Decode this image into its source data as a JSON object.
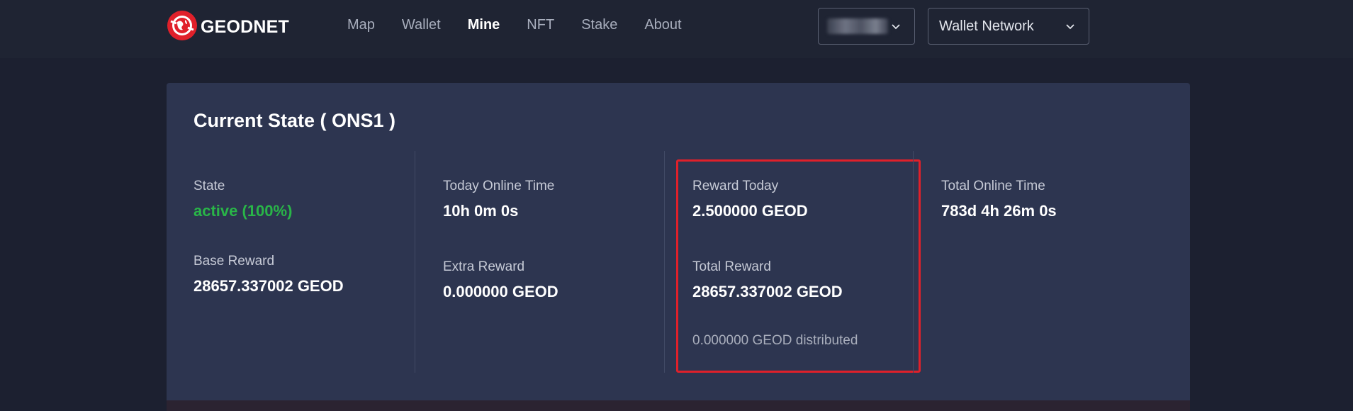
{
  "header": {
    "brand": "GEODNET",
    "nav": [
      {
        "label": "Map",
        "active": false
      },
      {
        "label": "Wallet",
        "active": false
      },
      {
        "label": "Mine",
        "active": true
      },
      {
        "label": "NFT",
        "active": false
      },
      {
        "label": "Stake",
        "active": false
      },
      {
        "label": "About",
        "active": false
      }
    ],
    "account_dropdown": {
      "icon": "chevron-down-icon"
    },
    "network_dropdown": {
      "label": "Wallet Network",
      "icon": "chevron-down-icon"
    }
  },
  "card": {
    "title": "Current State ( ONS1 )",
    "columns": [
      {
        "items": [
          {
            "label": "State",
            "value": "active (100%)",
            "status_color": "#29b548"
          },
          {
            "label": "Base Reward",
            "value": "28657.337002 GEOD"
          }
        ]
      },
      {
        "items": [
          {
            "label": "Today Online Time",
            "value": "10h 0m 0s"
          },
          {
            "label": "Extra Reward",
            "value": "0.000000 GEOD"
          }
        ]
      },
      {
        "highlighted": true,
        "items": [
          {
            "label": "Reward Today",
            "value": "2.500000 GEOD"
          },
          {
            "label": "Total Reward",
            "value": "28657.337002 GEOD"
          }
        ],
        "note": "0.000000 GEOD distributed"
      },
      {
        "items": [
          {
            "label": "Total Online Time",
            "value": "783d 4h 26m 0s"
          }
        ]
      }
    ]
  },
  "colors": {
    "background": "#1c2030",
    "card": "#2d3550",
    "brand_red": "#e0202a",
    "active_green": "#29b548"
  }
}
